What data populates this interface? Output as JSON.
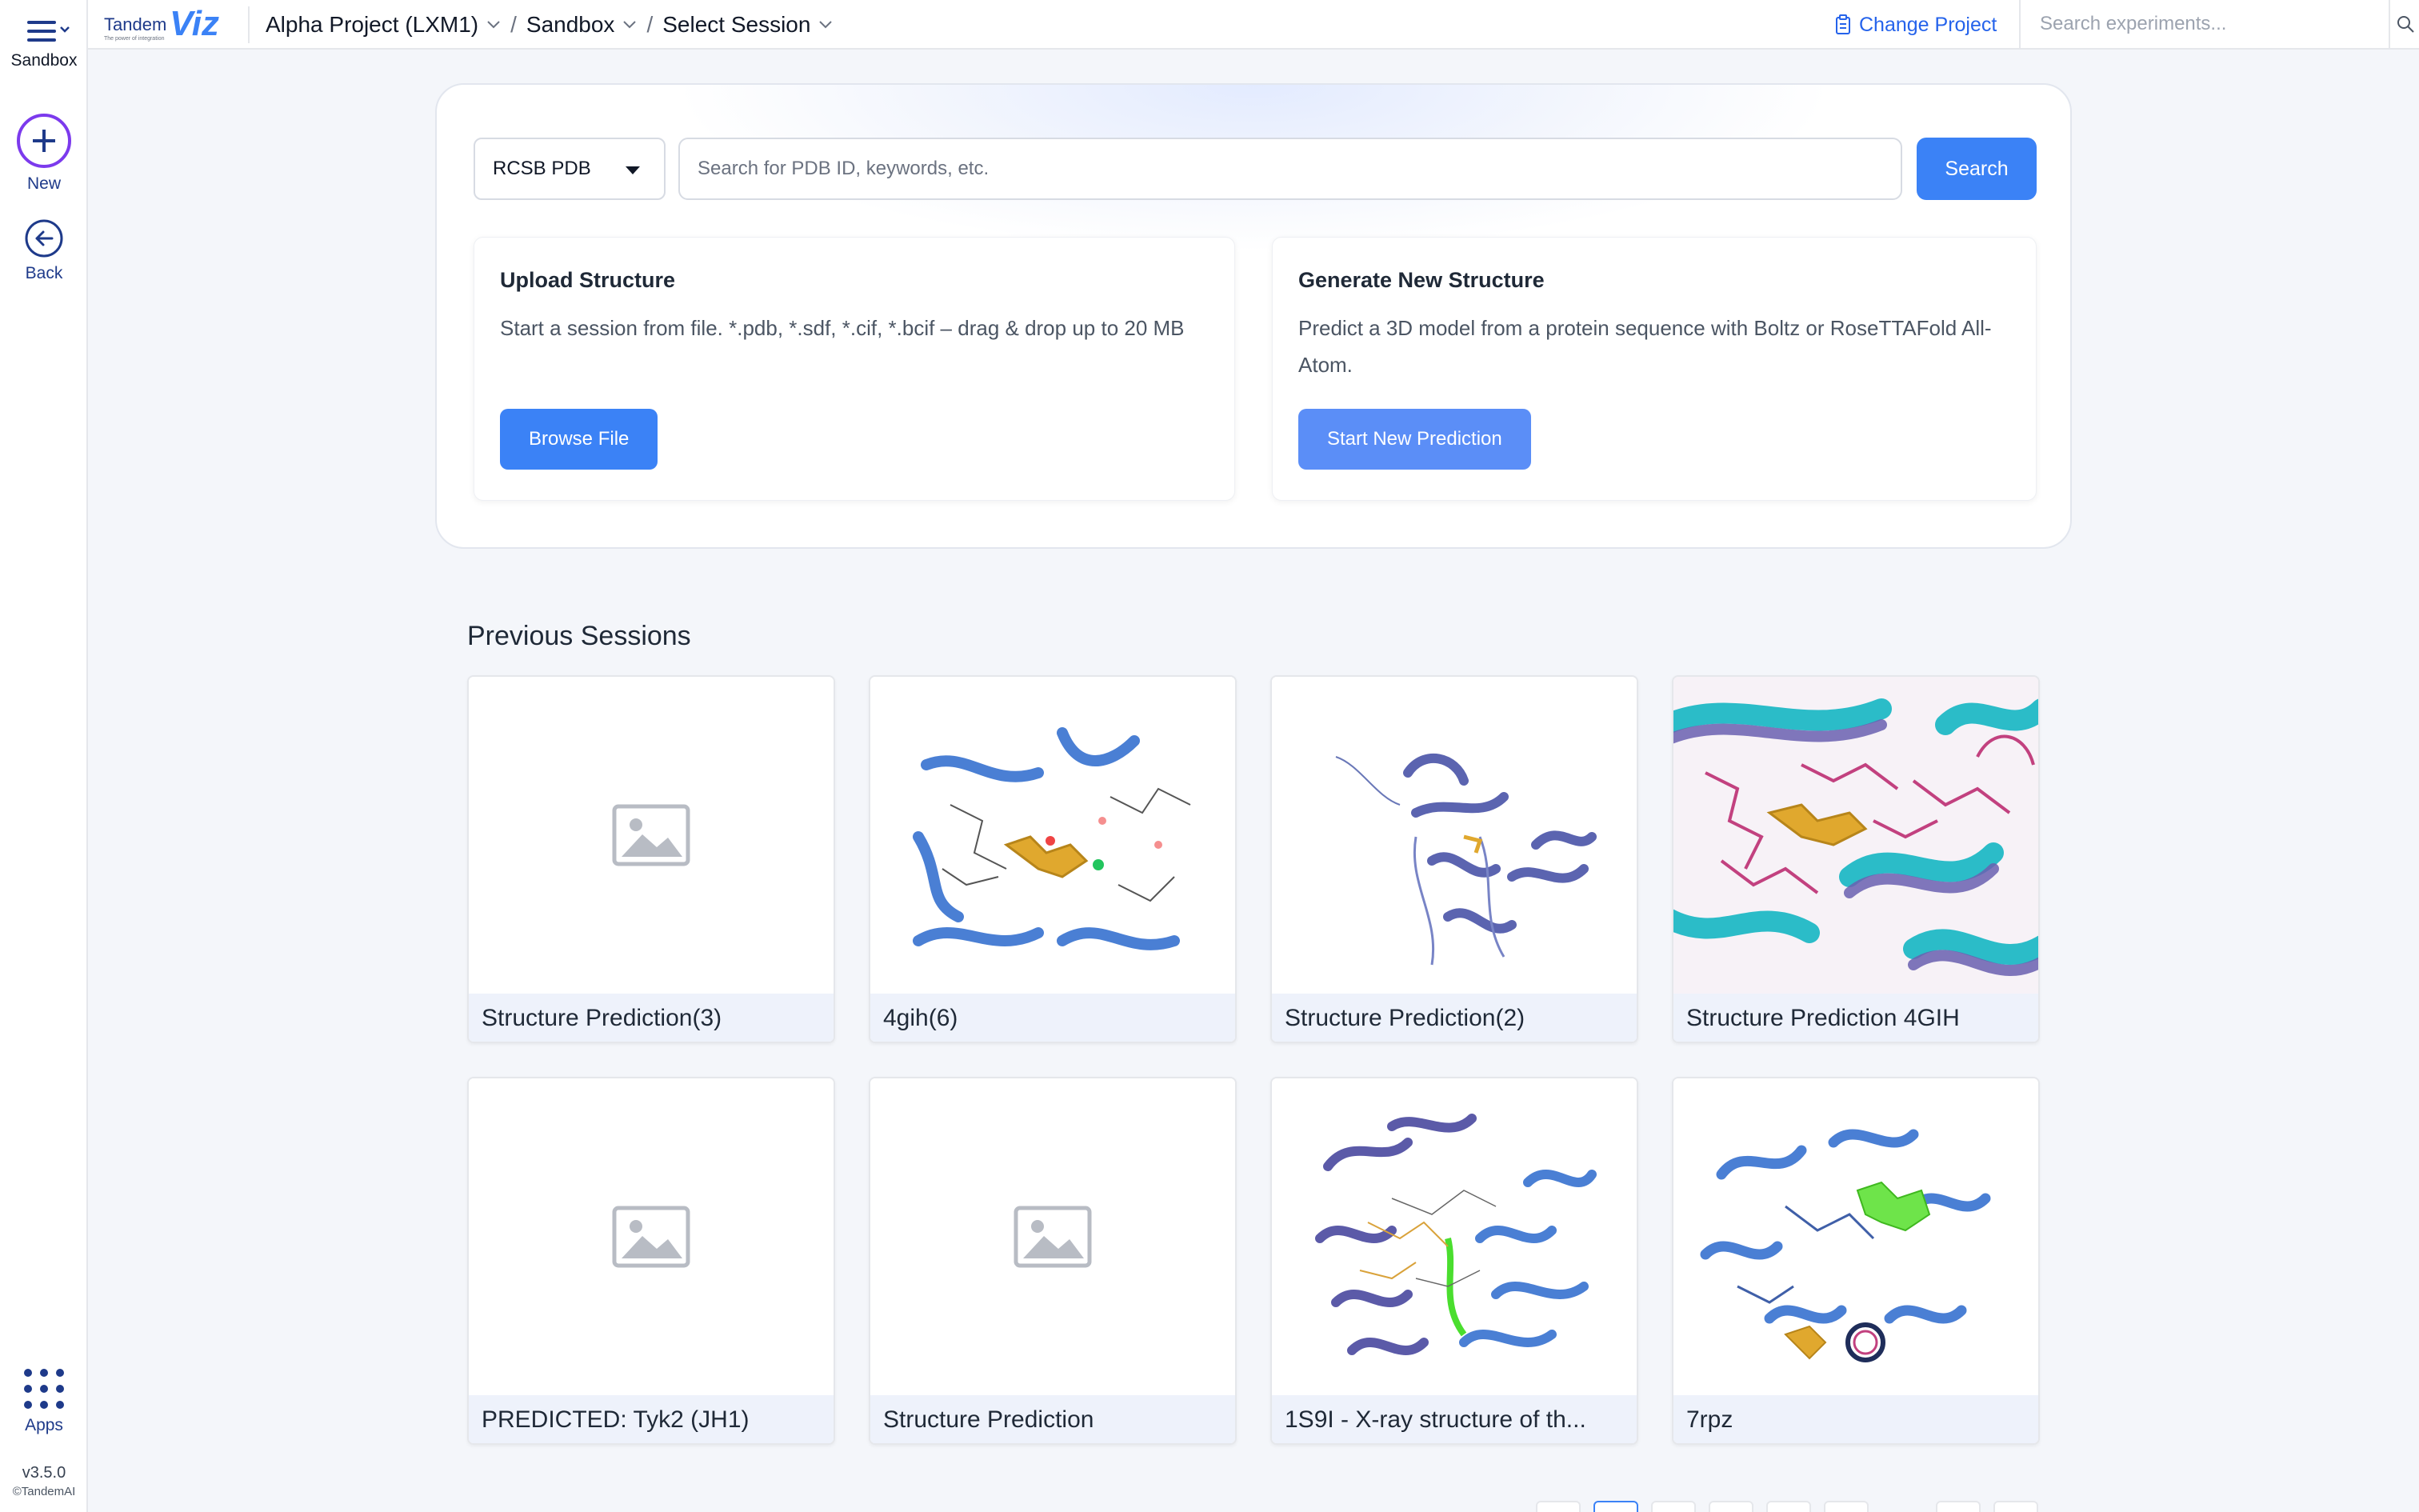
{
  "rail": {
    "menu_label": "Sandbox",
    "new_label": "New",
    "back_label": "Back",
    "apps_label": "Apps",
    "version": "v3.5.0",
    "copyright": "©TandemAI"
  },
  "header": {
    "logo_text_tandem": "Tandem",
    "logo_text_viz": "Viz",
    "logo_tagline": "The power of integration",
    "breadcrumbs": [
      "Alpha Project (LXM1)",
      "Sandbox",
      "Select Session"
    ],
    "change_project_label": "Change Project",
    "search_placeholder": "Search experiments..."
  },
  "panel": {
    "source_select_value": "RCSB PDB",
    "search_placeholder": "Search for PDB ID, keywords, etc.",
    "search_button": "Search",
    "upload": {
      "title": "Upload Structure",
      "description": "Start a session from file. *.pdb, *.sdf, *.cif, *.bcif – drag & drop up to 20 MB",
      "button": "Browse File"
    },
    "generate": {
      "title": "Generate New Structure",
      "description": "Predict a 3D model from a protein sequence with Boltz or RoseTTAFold All-Atom.",
      "button": "Start New Prediction"
    }
  },
  "sessions": {
    "title": "Previous Sessions",
    "items": [
      {
        "name": "Structure Prediction(3)",
        "thumb": "placeholder-image-icon"
      },
      {
        "name": "4gih(6)",
        "thumb": "protein-ribbon-ligand"
      },
      {
        "name": "Structure Prediction(2)",
        "thumb": "protein-ribbon-purple"
      },
      {
        "name": "Structure Prediction 4GIH",
        "thumb": "protein-overlay-teal-magenta"
      },
      {
        "name": "PREDICTED: Tyk2 (JH1)",
        "thumb": "placeholder-image-icon"
      },
      {
        "name": "Structure Prediction",
        "thumb": "placeholder-image-icon"
      },
      {
        "name": "1S9I - X-ray structure of th...",
        "thumb": "protein-ribbon-blue-purple"
      },
      {
        "name": "7rpz",
        "thumb": "protein-ribbon-blue-green"
      }
    ]
  },
  "colors": {
    "accent": "#3b82f6",
    "rail_text": "#1e3a8a",
    "new_ring": "#7c3aed"
  }
}
